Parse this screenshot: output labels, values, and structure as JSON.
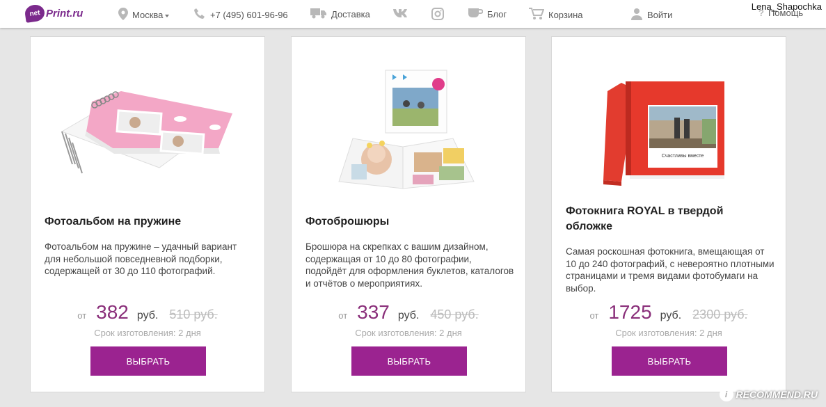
{
  "header": {
    "logo_mark": "net",
    "logo_text": "Print.ru",
    "city": "Москва",
    "phone": "+7 (495) 601-96-96",
    "delivery": "Доставка",
    "blog": "Блог",
    "cart": "Корзина",
    "login": "Войти",
    "help": "Помощь"
  },
  "watermarks": {
    "username": "Lena_Shapochka",
    "site": "RECOMMEND.RU"
  },
  "colors": {
    "accent": "#9b2390",
    "price": "#8a2f7a"
  },
  "cards": [
    {
      "title": "Фотоальбом на пружине",
      "description": "Фотоальбом на пружине – удачный вариант для небольшой повседневной подборки, содержащей от 30 до 110 фотографий.",
      "price_from": "от",
      "price": "382",
      "currency": "руб.",
      "old_price": "510 руб.",
      "lead_time": "Срок изготовления: 2 дня",
      "button": "ВЫБРАТЬ"
    },
    {
      "title": "Фотоброшюры",
      "description": "Брошюра на скрепках с вашим дизайном, содержащая от 10 до 80 фотографии, подойдёт для оформления буклетов, каталогов и отчётов о мероприятиях.",
      "price_from": "от",
      "price": "337",
      "currency": "руб.",
      "old_price": "450 руб.",
      "lead_time": "Срок изготовления: 2 дня",
      "button": "ВЫБРАТЬ"
    },
    {
      "title": "Фотокнига ROYAL в твердой обложке",
      "description": "Самая роскошная фотокнига, вмещающая от 10 до 240 фотографий, с невероятно плотными страницами и тремя видами фотобумаги на выбор.",
      "price_from": "от",
      "price": "1725",
      "currency": "руб.",
      "old_price": "2300 руб.",
      "lead_time": "Срок изготовления: 2 дня",
      "button": "ВЫБРАТЬ",
      "cover_caption": "Счастливы вместе"
    }
  ]
}
